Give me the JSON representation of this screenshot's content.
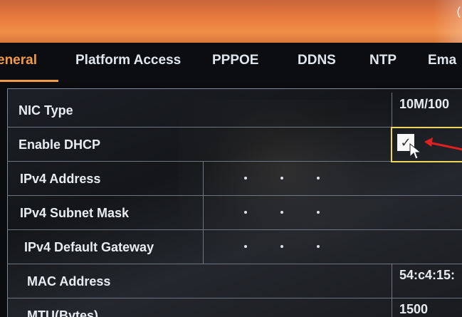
{
  "tabs": [
    {
      "label": "eneral",
      "active": true
    },
    {
      "label": "Platform Access",
      "active": false
    },
    {
      "label": "PPPOE",
      "active": false
    },
    {
      "label": "DDNS",
      "active": false
    },
    {
      "label": "NTP",
      "active": false
    },
    {
      "label": "Ema",
      "active": false
    }
  ],
  "fields": {
    "nic_type": {
      "label": "NIC Type",
      "value": "10M/100"
    },
    "enable_dhcp": {
      "label": "Enable DHCP",
      "checked": true
    },
    "ipv4_address": {
      "label": "IPv4 Address"
    },
    "ipv4_subnet_mask": {
      "label": "IPv4 Subnet Mask"
    },
    "ipv4_default_gateway": {
      "label": "IPv4 Default Gateway"
    },
    "mac_address": {
      "label": "MAC Address",
      "value": "54:c4:15:"
    },
    "mtu": {
      "label": "MTU(Bytes)",
      "value": "1500"
    }
  },
  "colors": {
    "title_bar": "#e77a3e",
    "active_tab": "#f39a45",
    "arrow": "#e02020",
    "checkbox_frame": "#e9d560"
  }
}
